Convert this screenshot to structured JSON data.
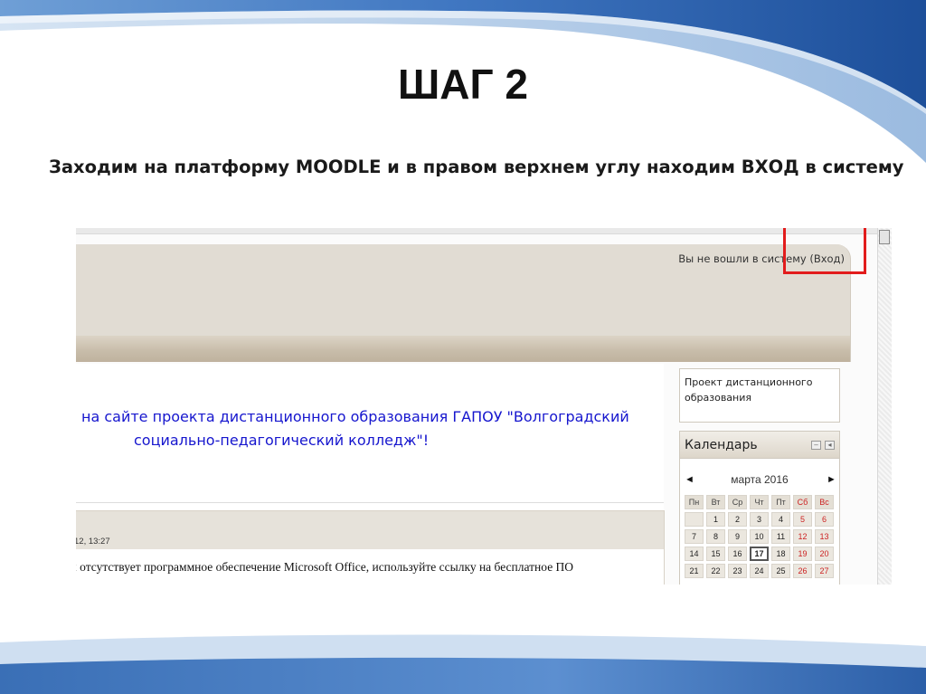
{
  "slide": {
    "title": "ШАГ 2",
    "subtitle": "Заходим на платформу MOODLE и в правом верхнем углу находим ВХОД в систему"
  },
  "moodle": {
    "login_text": "Вы не вошли в систему (Вход)",
    "welcome_line1": "на сайте проекта дистанционного образования ГАПОУ \"Волгоградский",
    "welcome_line2": "социально-педагогический колледж\"!",
    "news_date": "12, 13:27",
    "news_text": "х отсутствует программное обеспечение Microsoft Office, используйте ссылку на бесплатное ПО",
    "project_block": "Проект дистанционного образования",
    "calendar": {
      "title": "Календарь",
      "prev": "◄",
      "next": "►",
      "month": "марта 2016",
      "weekdays": [
        "Пн",
        "Вт",
        "Ср",
        "Чт",
        "Пт",
        "Сб",
        "Вс"
      ],
      "weeks": [
        [
          "",
          "1",
          "2",
          "3",
          "4",
          "5",
          "6"
        ],
        [
          "7",
          "8",
          "9",
          "10",
          "11",
          "12",
          "13"
        ],
        [
          "14",
          "15",
          "16",
          "17",
          "18",
          "19",
          "20"
        ],
        [
          "21",
          "22",
          "23",
          "24",
          "25",
          "26",
          "27"
        ]
      ],
      "today": "17"
    }
  },
  "colors": {
    "highlight": "#e21c1c",
    "welcome_text": "#1616ce",
    "theme_blue": "#2f6fb8"
  }
}
